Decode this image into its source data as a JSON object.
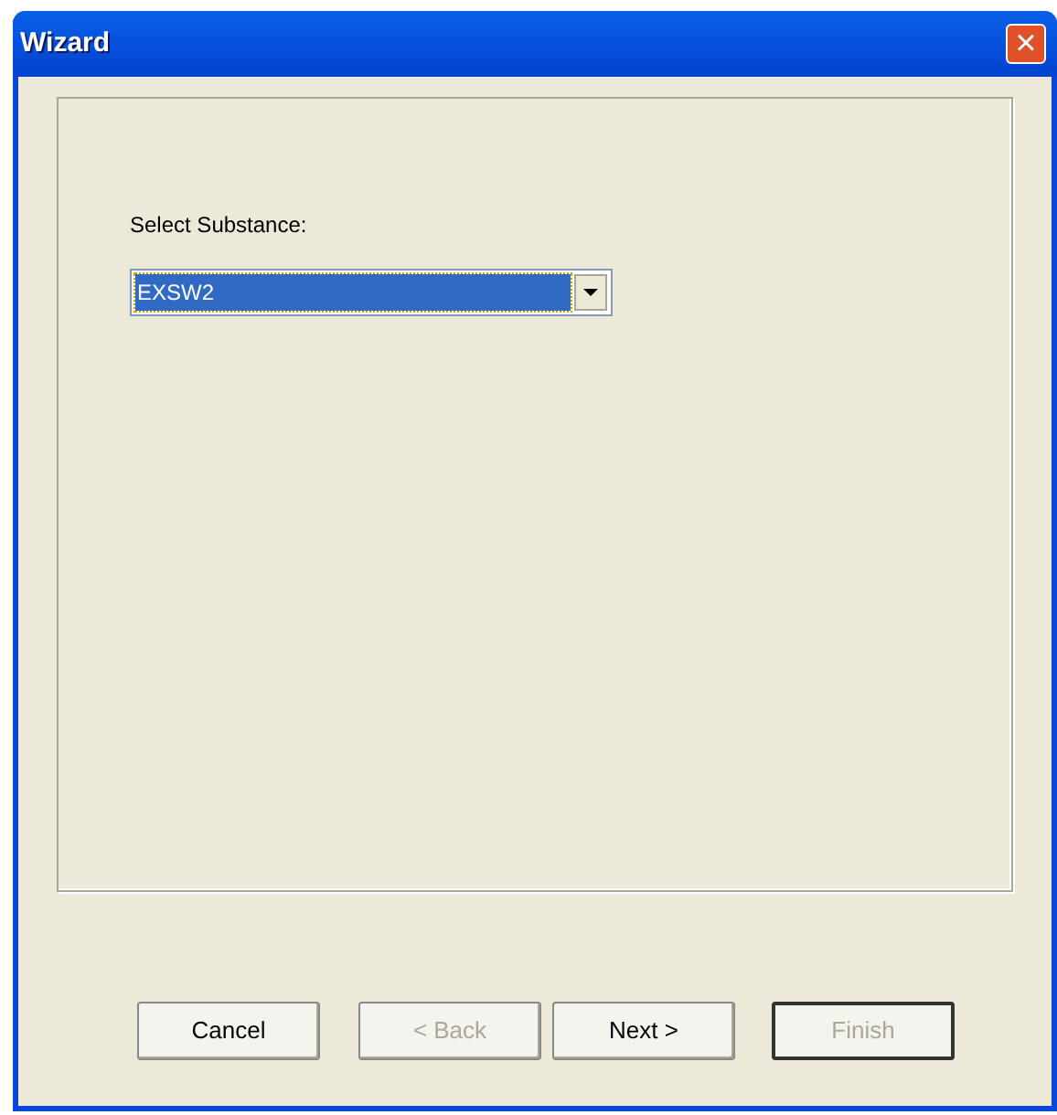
{
  "window": {
    "title": "Wizard",
    "close": "×"
  },
  "substance": {
    "label": "Select Substance:",
    "value": "EXSW2",
    "focused": true
  },
  "buttons": [
    {
      "label": "Cancel",
      "disabled": false,
      "default": false
    },
    {
      "label": "< Back",
      "disabled": true,
      "default": false
    },
    {
      "label": "Next >",
      "disabled": false,
      "default": false
    },
    {
      "label": "Finish",
      "disabled": true,
      "default": true
    }
  ]
}
